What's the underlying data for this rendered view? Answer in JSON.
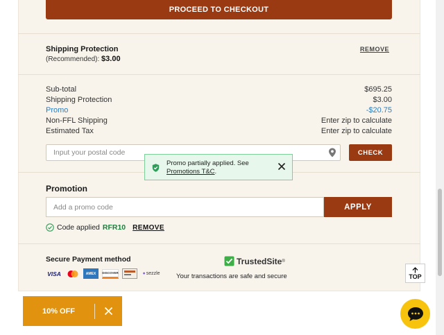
{
  "checkout": {
    "label": "PROCEED TO CHECKOUT"
  },
  "shipping_protection": {
    "title": "Shipping Protection",
    "recommended_label": "(Recommended):",
    "price": "$3.00",
    "remove_label": "REMOVE"
  },
  "summary": {
    "rows": [
      {
        "label": "Sub-total",
        "value": "$695.25"
      },
      {
        "label": "Shipping Protection",
        "value": "$3.00"
      },
      {
        "label": "Promo",
        "value": "-$20.75"
      },
      {
        "label": "Non-FFL Shipping",
        "value": "Enter zip to calculate"
      },
      {
        "label": "Estimated Tax",
        "value": "Enter zip to calculate"
      }
    ]
  },
  "zip": {
    "placeholder": "Input your postal code",
    "check_label": "CHECK"
  },
  "toast": {
    "message": "Promo partially applied. See",
    "link": "Promotions T&C",
    "suffix": "."
  },
  "promotion": {
    "title": "Promotion",
    "placeholder": "Add a promo code",
    "apply_label": "APPLY",
    "applied_text": "Code applied",
    "code": "RFR10",
    "remove_label": "REMOVE"
  },
  "payment": {
    "title": "Secure Payment method",
    "cards": [
      "VISA",
      "AMEX",
      "DISCOVER",
      "sezzle"
    ],
    "trusted_label": "TrustedSite",
    "trusted_mark": "®",
    "secure_text": "Your transactions are safe and secure"
  },
  "top_button": {
    "label": "TOP"
  },
  "discount": {
    "label": "10% OFF"
  },
  "colors": {
    "accent": "#9a3a12",
    "promo_blue": "#2a7dc0",
    "success_green": "#1e7e3e",
    "discount_orange": "#e1930f",
    "chat_yellow": "#f7c30c"
  }
}
